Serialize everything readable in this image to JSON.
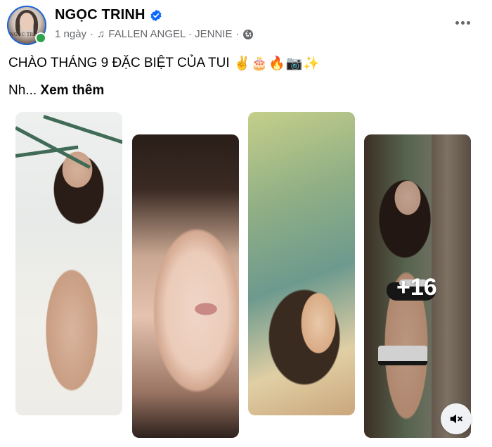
{
  "post": {
    "author": {
      "name": "NGỌC TRINH",
      "avatar_text": "NGỌC TRINH",
      "verified": true,
      "online": true
    },
    "meta": {
      "time": "1 ngày",
      "separator": "·",
      "music": "FALLEN ANGEL · JENNIE",
      "privacy_icon": "globe-icon"
    },
    "caption": {
      "text": "CHÀO THÁNG 9 ĐẶC BIỆT CỦA TUI",
      "emojis": "✌️🎂🔥📷✨",
      "truncated_text": "Nh...",
      "see_more_label": "Xem thêm"
    },
    "photos": {
      "items": [
        {
          "name": "photo-1"
        },
        {
          "name": "photo-2"
        },
        {
          "name": "photo-3"
        },
        {
          "name": "photo-4"
        }
      ],
      "more_count": "+16"
    },
    "controls": {
      "more_icon": "more-horizontal-icon",
      "mute_icon": "speaker-muted-icon"
    }
  },
  "colors": {
    "text_primary": "#050505",
    "text_secondary": "#65676b",
    "verified_blue": "#0866ff",
    "online_green": "#31a24c"
  }
}
